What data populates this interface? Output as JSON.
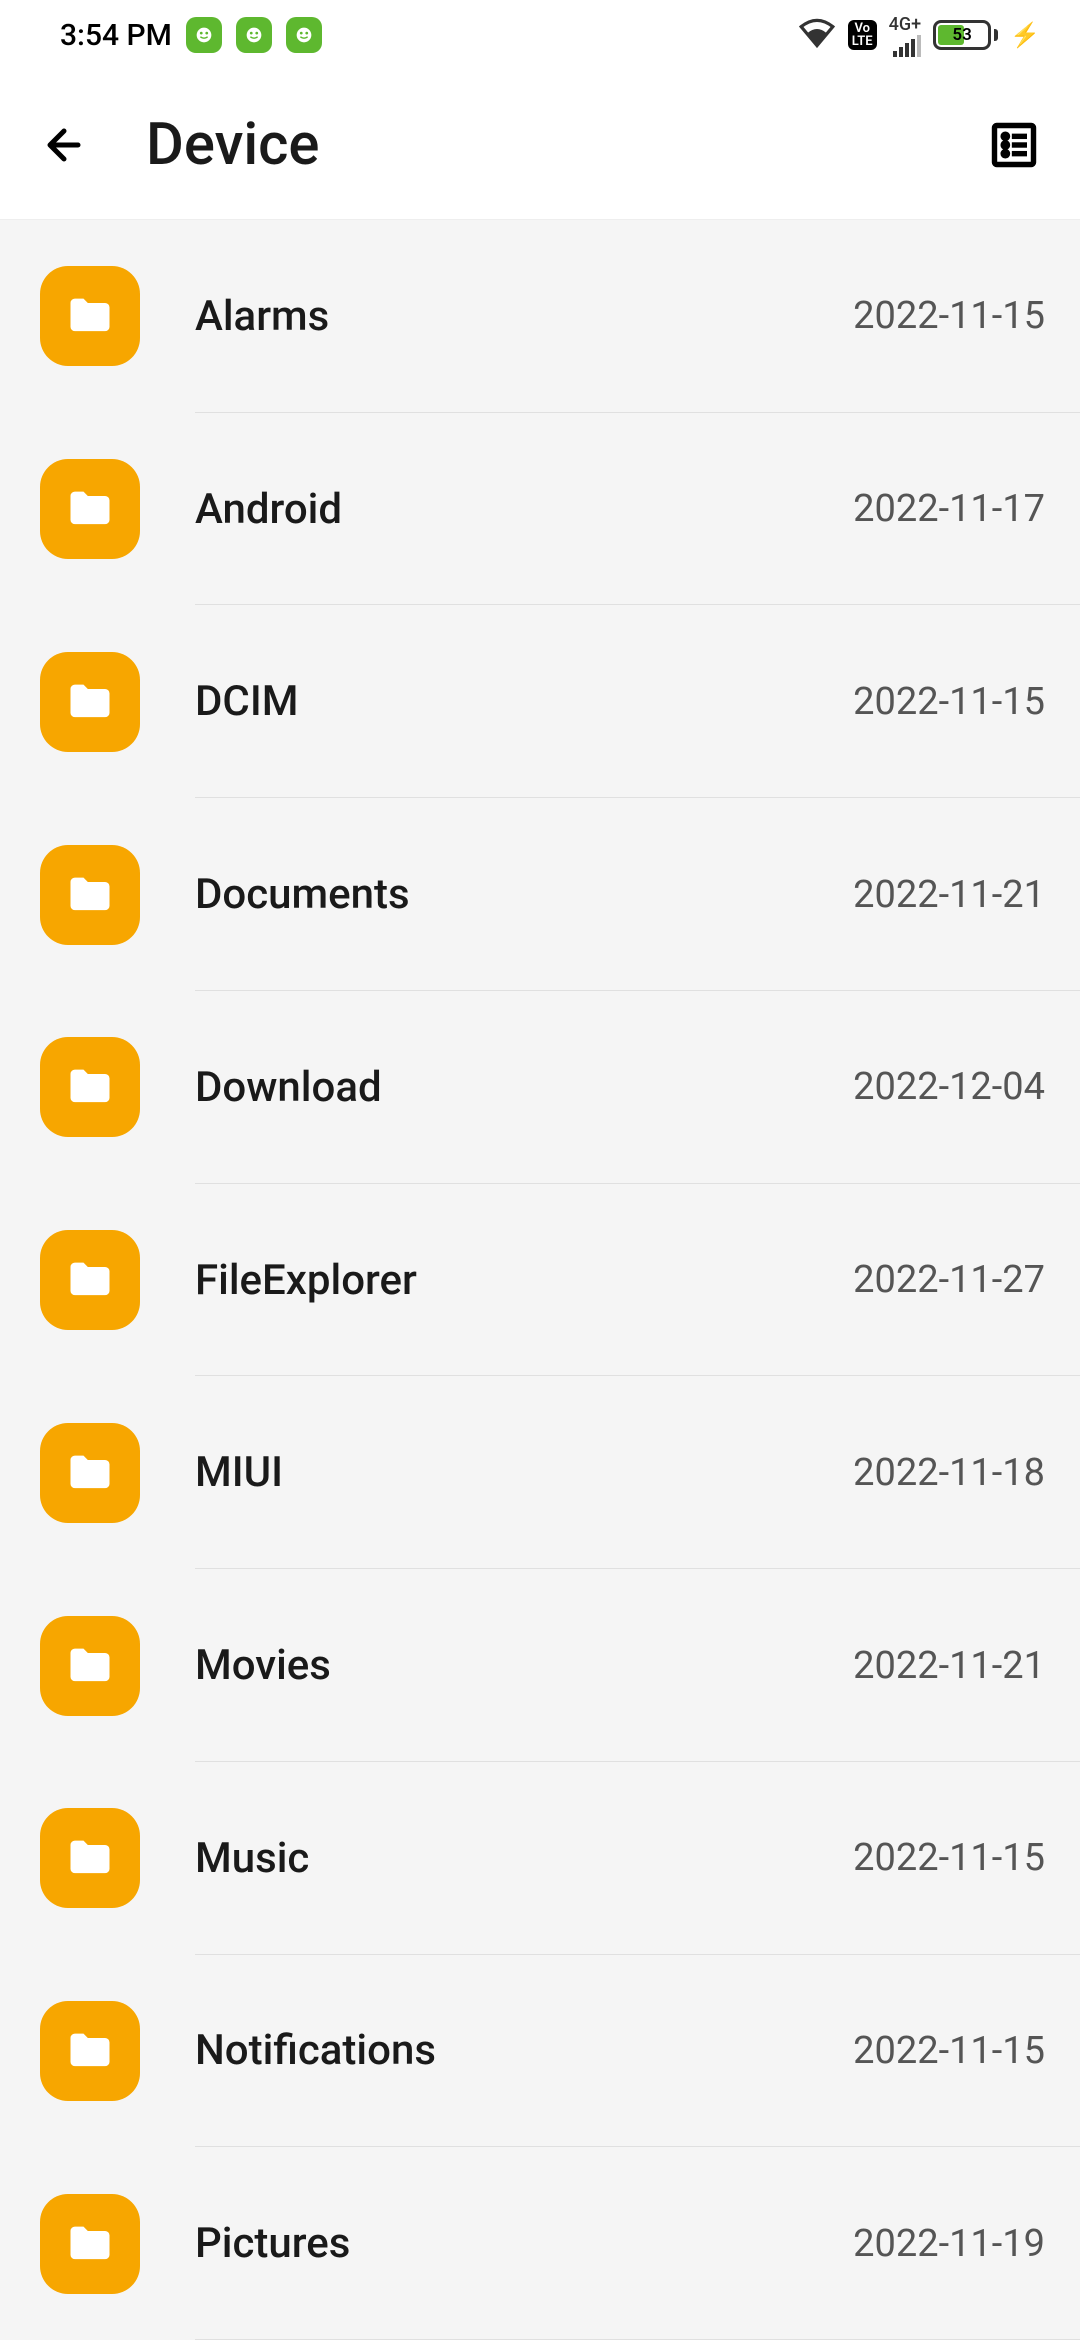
{
  "statusbar": {
    "time": "3:54 PM",
    "battery_percent": "53",
    "network_label": "4G+",
    "volte_label": "Vo\nLTE"
  },
  "header": {
    "title": "Device"
  },
  "folders": [
    {
      "name": "Alarms",
      "date": "2022-11-15"
    },
    {
      "name": "Android",
      "date": "2022-11-17"
    },
    {
      "name": "DCIM",
      "date": "2022-11-15"
    },
    {
      "name": "Documents",
      "date": "2022-11-21"
    },
    {
      "name": "Download",
      "date": "2022-12-04"
    },
    {
      "name": "FileExplorer",
      "date": "2022-11-27"
    },
    {
      "name": "MIUI",
      "date": "2022-11-18"
    },
    {
      "name": "Movies",
      "date": "2022-11-21"
    },
    {
      "name": "Music",
      "date": "2022-11-15"
    },
    {
      "name": "Notifications",
      "date": "2022-11-15"
    },
    {
      "name": "Pictures",
      "date": "2022-11-19"
    }
  ]
}
